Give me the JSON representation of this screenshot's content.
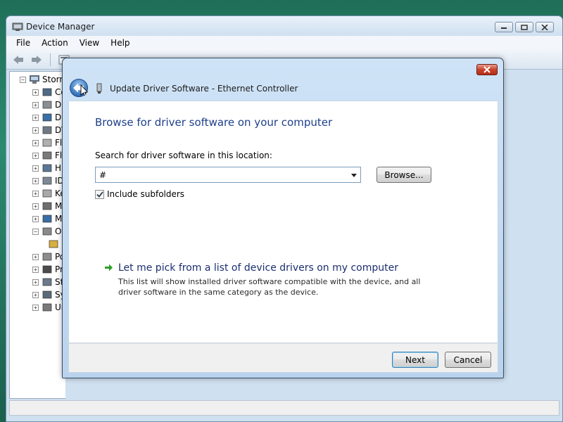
{
  "device_manager": {
    "title": "Device Manager",
    "menu": [
      "File",
      "Action",
      "View",
      "Help"
    ],
    "tree": {
      "root_label": "Storm",
      "items": [
        "Co",
        "Di",
        "Di",
        "DV",
        "Flo",
        "Flo",
        "Hu",
        "ID",
        "Ke",
        "Mi",
        "Mo",
        "Ot",
        "",
        "Po",
        "Pr",
        "Sto",
        "Sy",
        "Un"
      ]
    }
  },
  "wizard": {
    "title": "Update Driver Software - Ethernet Controller",
    "heading": "Browse for driver software on your computer",
    "search_label": "Search for driver software in this location:",
    "path_value": "#",
    "browse_label": "Browse...",
    "include_subfolders_label": "Include subfolders",
    "include_subfolders_checked": true,
    "pick_link": "Let me pick from a list of device drivers on my computer",
    "pick_description": "This list will show installed driver software compatible with the device, and all driver software in the same category as the device.",
    "next_label": "Next",
    "cancel_label": "Cancel"
  },
  "colors": {
    "heading": "#1e3f8a",
    "link": "#1b2f6e",
    "arrow_green": "#2e9e28",
    "close_red": "#c8412a"
  }
}
